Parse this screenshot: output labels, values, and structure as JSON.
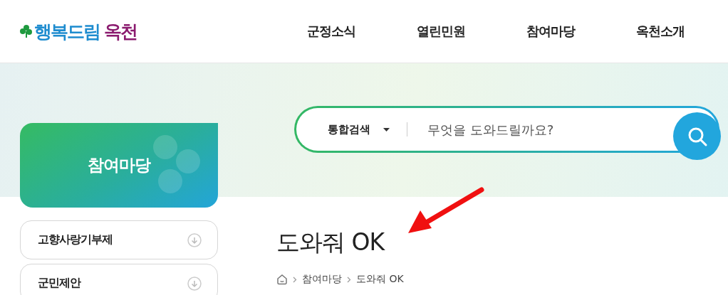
{
  "logo": {
    "main": "행복드림",
    "accent": "옥천"
  },
  "nav": [
    {
      "label": "군정소식"
    },
    {
      "label": "열린민원"
    },
    {
      "label": "참여마당"
    },
    {
      "label": "옥천소개"
    }
  ],
  "search": {
    "category": "통합검색",
    "placeholder": "무엇을 도와드릴까요?"
  },
  "sidebar": {
    "title": "참여마당",
    "items": [
      {
        "label": "고향사랑기부제",
        "expanded": false
      },
      {
        "label": "군민제안",
        "expanded": false
      }
    ]
  },
  "page_title": "도와줘 OK",
  "breadcrumb": [
    "참여마당",
    "도와줘 OK"
  ]
}
